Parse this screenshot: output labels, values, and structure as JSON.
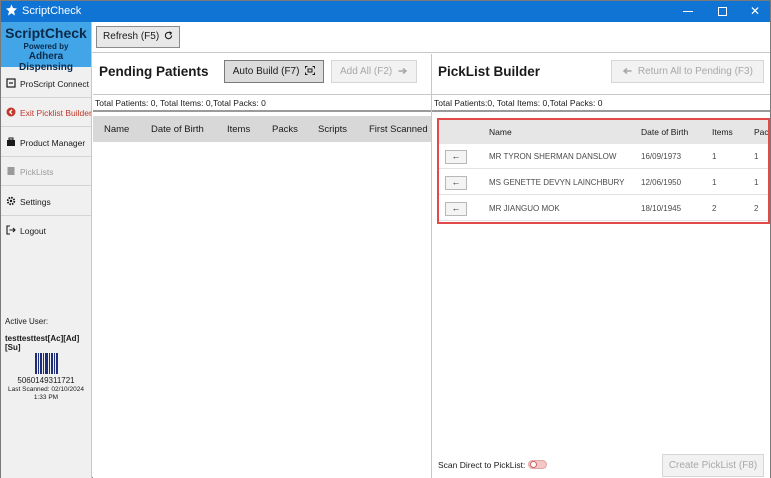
{
  "window": {
    "title": "ScriptCheck",
    "controls": {
      "minimize": "",
      "maximize": "",
      "close": "✕"
    }
  },
  "sidebar": {
    "brand": {
      "name": "ScriptCheck",
      "powered_by": "Powered by",
      "company": "Adhera Dispensing"
    },
    "items": [
      {
        "label": "ProScript Connect",
        "icon": "proscript-icon"
      },
      {
        "label": "Exit Picklist Builder",
        "icon": "exit-icon"
      },
      {
        "label": "Product Manager",
        "icon": "product-icon"
      },
      {
        "label": "PickLists",
        "icon": "picklist-icon"
      },
      {
        "label": "Settings",
        "icon": "gear-icon"
      },
      {
        "label": "Logout",
        "icon": "logout-icon"
      }
    ],
    "active_user_label": "Active User:",
    "active_user": "testtesttest[Ac][Ad][Su]",
    "barcode_number": "5060149311721",
    "last_scanned_line1": "Last Scanned: 02/10/2024",
    "last_scanned_line2": "1:33 PM"
  },
  "toolbar": {
    "refresh_label": "Refresh (F5)"
  },
  "pending": {
    "title": "Pending Patients",
    "auto_build_label": "Auto Build (F7)",
    "add_all_label": "Add All (F2)",
    "totals": "Total Patients: 0, Total Items: 0,Total Packs: 0",
    "columns": [
      "Name",
      "Date of Birth",
      "Items",
      "Packs",
      "Scripts",
      "First Scanned"
    ]
  },
  "picklist": {
    "title": "PickList Builder",
    "return_all_label": "Return All to Pending (F3)",
    "totals": "Total Patients:0, Total Items: 0,Total Packs: 0",
    "columns": [
      "Name",
      "Date of Birth",
      "Items",
      "Pack"
    ],
    "rows": [
      {
        "name": "MR TYRON SHERMAN DANSLOW",
        "dob": "16/09/1973",
        "items": "1",
        "packs": "1"
      },
      {
        "name": "MS GENETTE DEVYN LAINCHBURY",
        "dob": "12/06/1950",
        "items": "1",
        "packs": "1"
      },
      {
        "name": "MR JIANGUO MOK",
        "dob": "18/10/1945",
        "items": "2",
        "packs": "2"
      }
    ],
    "back_glyph": "←",
    "scan_direct_label": "Scan Direct to PickList:",
    "create_label": "Create PickList (F8)"
  },
  "colors": {
    "titlebar": "#0f74d4",
    "brand": "#41a5e8",
    "highlight": "#e24a4a",
    "exit_text": "#c0392b"
  }
}
